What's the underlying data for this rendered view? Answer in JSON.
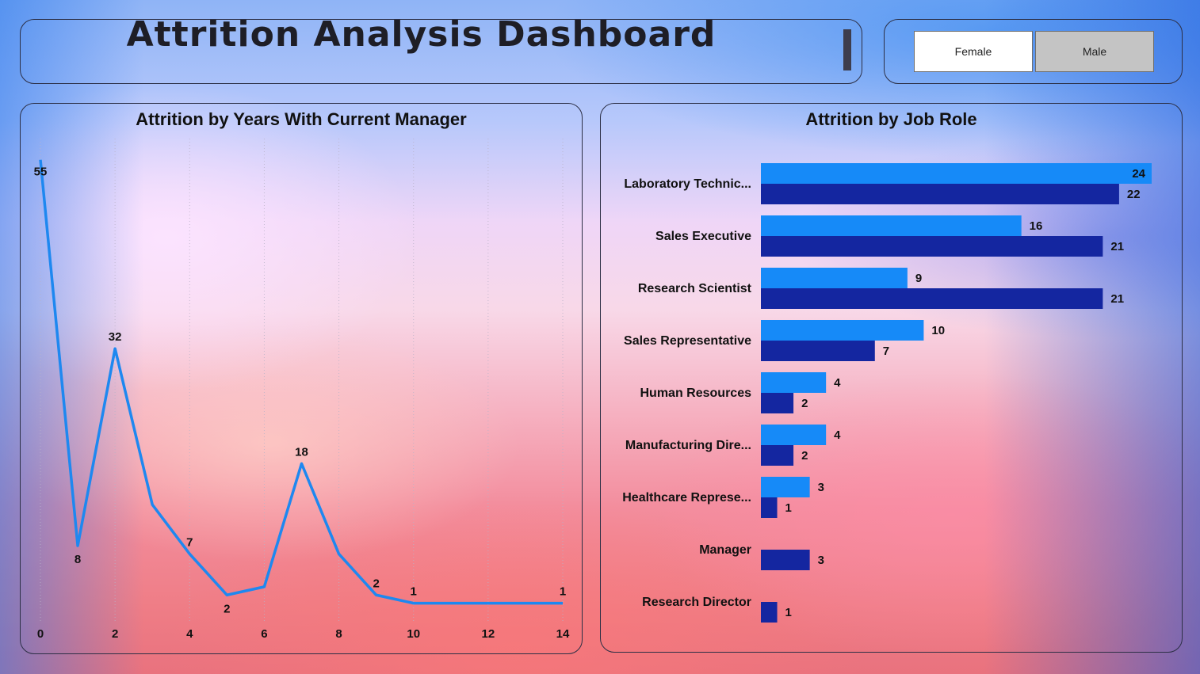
{
  "header": {
    "title": "Attrition Analysis Dashboard"
  },
  "slicer": {
    "options": [
      "Female",
      "Male"
    ],
    "selected": "Female"
  },
  "colors": {
    "female": "#168af8",
    "male": "#1426a0",
    "line": "#1e88f0"
  },
  "chart_data": [
    {
      "type": "line",
      "title": "Attrition by Years With Current Manager",
      "x": [
        0,
        1,
        2,
        3,
        4,
        5,
        6,
        7,
        8,
        9,
        10,
        11,
        12,
        13,
        14
      ],
      "y": [
        55,
        8,
        32,
        13,
        7,
        2,
        3,
        18,
        7,
        2,
        1,
        1,
        1,
        1,
        1
      ],
      "data_labels": {
        "0": "55",
        "1": "8",
        "2": "32",
        "4": "7",
        "5": "2",
        "7": "18",
        "9": "2",
        "10": "1",
        "14": "1"
      },
      "xticks": [
        0,
        2,
        4,
        6,
        8,
        10,
        12,
        14
      ],
      "xlim": [
        0,
        14
      ],
      "ylim": [
        0,
        57
      ],
      "grid": "vertical dotted"
    },
    {
      "type": "bar",
      "orientation": "horizontal",
      "title": "Attrition by Job Role",
      "categories": [
        "Laboratory Technic...",
        "Sales Executive",
        "Research Scientist",
        "Sales Representative",
        "Human Resources",
        "Manufacturing Dire...",
        "Healthcare Represe...",
        "Manager",
        "Research Director"
      ],
      "series": [
        {
          "values": [
            24,
            16,
            9,
            10,
            4,
            4,
            3,
            null,
            null
          ]
        },
        {
          "values": [
            22,
            21,
            21,
            7,
            2,
            2,
            1,
            3,
            1
          ]
        }
      ],
      "xlim": [
        0,
        24
      ]
    }
  ]
}
